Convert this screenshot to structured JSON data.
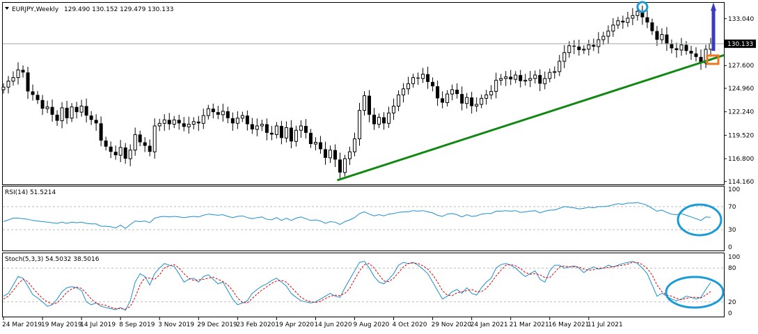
{
  "header": {
    "symbol": "EURJPY,Weekly",
    "ohlc": "129.490 130.152 129.479 130.133"
  },
  "chart_data": [
    {
      "type": "candlestick",
      "title": "EURJPY,Weekly",
      "ohlc": {
        "open": 129.49,
        "high": 130.152,
        "low": 129.479,
        "close": 130.133
      },
      "current_price": "130.133",
      "y_ticks": [
        "133.040",
        "127.600",
        "124.960",
        "122.240",
        "119.520",
        "116.800",
        "114.160"
      ],
      "ylim": [
        113.9,
        134.8
      ],
      "x_labels": [
        "24 Mar 2019",
        "19 May 2019",
        "14 Jul 2019",
        "8 Sep 2019",
        "3 Nov 2019",
        "29 Dec 2019",
        "23 Feb 2020",
        "19 Apr 2020",
        "14 Jun 2020",
        "9 Aug 2020",
        "4 Oct 2020",
        "29 Nov 2020",
        "24 Jan 2021",
        "21 Mar 2021",
        "16 May 2021",
        "11 Jul 2021"
      ],
      "closes": [
        125.1,
        125.8,
        126.2,
        127.1,
        126.8,
        124.6,
        124.2,
        123.6,
        122.6,
        122.8,
        121.9,
        121.2,
        122.7,
        121.5,
        122.8,
        122.2,
        122.9,
        121.8,
        121.3,
        120.9,
        118.9,
        118.2,
        117.6,
        117.2,
        118.1,
        116.8,
        117.8,
        119.6,
        118.7,
        118.3,
        117.6,
        120.6,
        120.9,
        121.3,
        120.8,
        121.3,
        120.9,
        120.5,
        120.8,
        121.1,
        120.9,
        121.8,
        122.6,
        122.2,
        121.9,
        122.3,
        121.5,
        120.9,
        121.5,
        121.8,
        120.8,
        120.2,
        120.6,
        120.8,
        119.8,
        119.6,
        120.6,
        119.2,
        120.4,
        118.8,
        120.1,
        120.6,
        119.8,
        118.5,
        118.7,
        117.9,
        116.9,
        117.8,
        116.7,
        115.2,
        116.8,
        117.6,
        119.1,
        122.4,
        124.1,
        121.9,
        120.8,
        121.6,
        120.9,
        122.1,
        122.9,
        124.2,
        124.9,
        125.5,
        126.2,
        126.1,
        126.6,
        125.7,
        125.2,
        123.8,
        123.3,
        124.3,
        124.8,
        124.3,
        123.2,
        123.9,
        122.9,
        123.1,
        123.8,
        124.2,
        124.6,
        125.9,
        126.1,
        126.3,
        126.0,
        126.5,
        125.8,
        125.9,
        126.1,
        126.5,
        125.5,
        126.1,
        126.8,
        126.9,
        128.1,
        129.1,
        129.9,
        129.8,
        129.4,
        129.5,
        130.0,
        129.8,
        130.6,
        131.0,
        131.6,
        132.3,
        132.8,
        132.6,
        133.1,
        133.4,
        133.9,
        133.2,
        132.6,
        131.6,
        130.6,
        131.2,
        130.1,
        129.6,
        129.4,
        130.0,
        129.3,
        129.0,
        128.6,
        127.9,
        129.49,
        130.133
      ],
      "overlays": [
        "green ascending trendline from Apr 2020 low to Aug 2021",
        "blue circle marks May 2021 high",
        "blue up arrow above last bar",
        "orange square at trendline touch"
      ],
      "colors": {
        "candle": "#000000",
        "trendline": "#118811",
        "highlight_circle": "#1a9bd7",
        "arrow": "#3b3bc2",
        "marker": "#f07822"
      }
    },
    {
      "type": "line",
      "title": "RSI(14) 51.5214",
      "y_ticks": [
        "100",
        "70",
        "30",
        "0"
      ],
      "ylim": [
        0,
        100
      ],
      "levels": [
        30,
        70
      ],
      "series": [
        {
          "name": "RSI(14)",
          "values": [
            44,
            47,
            50,
            50,
            49,
            48,
            46,
            45,
            44,
            43,
            42,
            41,
            43,
            41,
            43,
            42,
            43,
            41,
            40,
            40,
            36,
            36,
            35,
            33,
            38,
            32,
            39,
            45,
            44,
            45,
            42,
            50,
            52,
            53,
            52,
            53,
            52,
            51,
            52,
            53,
            52,
            55,
            57,
            56,
            55,
            56,
            53,
            51,
            53,
            54,
            51,
            49,
            51,
            52,
            48,
            47,
            51,
            46,
            50,
            46,
            50,
            52,
            49,
            46,
            47,
            45,
            41,
            44,
            43,
            39,
            44,
            47,
            51,
            58,
            61,
            57,
            54,
            56,
            54,
            57,
            58,
            60,
            61,
            61,
            63,
            62,
            63,
            61,
            59,
            55,
            53,
            57,
            58,
            56,
            52,
            56,
            53,
            54,
            57,
            58,
            58,
            62,
            62,
            63,
            62,
            63,
            60,
            61,
            62,
            63,
            59,
            62,
            64,
            64,
            67,
            70,
            69,
            68,
            66,
            67,
            69,
            68,
            70,
            70,
            71,
            73,
            75,
            74,
            76,
            76,
            77,
            75,
            72,
            67,
            62,
            64,
            60,
            57,
            56,
            58,
            55,
            52,
            49,
            46,
            52,
            51.5
          ]
        }
      ],
      "colors": {
        "line": "#1a8fcf",
        "levels": "#bbbbbb"
      }
    },
    {
      "type": "line",
      "title": "Stoch(5,3,3) 54.5032 38.5016",
      "y_ticks": [
        "100",
        "80",
        "20",
        "0"
      ],
      "ylim": [
        0,
        100
      ],
      "levels": [
        20,
        80
      ],
      "series": [
        {
          "name": "main",
          "values": [
            30,
            35,
            50,
            65,
            62,
            48,
            33,
            27,
            20,
            12,
            15,
            25,
            38,
            45,
            47,
            45,
            40,
            20,
            15,
            18,
            12,
            10,
            8,
            6,
            10,
            5,
            22,
            55,
            70,
            65,
            50,
            70,
            80,
            88,
            85,
            83,
            70,
            55,
            60,
            62,
            55,
            65,
            68,
            60,
            52,
            55,
            40,
            25,
            15,
            18,
            22,
            35,
            42,
            48,
            52,
            58,
            62,
            55,
            48,
            35,
            28,
            22,
            20,
            18,
            20,
            25,
            30,
            35,
            30,
            28,
            45,
            60,
            75,
            90,
            92,
            80,
            65,
            55,
            52,
            60,
            70,
            85,
            90,
            88,
            90,
            85,
            78,
            70,
            55,
            40,
            25,
            30,
            38,
            42,
            35,
            45,
            35,
            32,
            45,
            55,
            62,
            80,
            86,
            88,
            85,
            80,
            72,
            65,
            70,
            75,
            60,
            55,
            75,
            85,
            85,
            80,
            82,
            84,
            80,
            72,
            78,
            82,
            78,
            80,
            85,
            82,
            85,
            88,
            90,
            92,
            88,
            80,
            70,
            50,
            30,
            35,
            30,
            25,
            22,
            25,
            30,
            28,
            25,
            28,
            42,
            54.5
          ]
        },
        {
          "name": "signal",
          "values": [
            25,
            30,
            40,
            52,
            60,
            56,
            45,
            35,
            26,
            20,
            16,
            18,
            27,
            37,
            43,
            46,
            44,
            35,
            25,
            18,
            15,
            14,
            10,
            8,
            8,
            7,
            12,
            28,
            50,
            63,
            62,
            60,
            68,
            80,
            84,
            86,
            80,
            70,
            62,
            58,
            59,
            60,
            62,
            64,
            60,
            56,
            50,
            40,
            27,
            19,
            18,
            26,
            34,
            41,
            47,
            53,
            57,
            58,
            55,
            46,
            37,
            28,
            23,
            20,
            19,
            21,
            26,
            30,
            32,
            31,
            35,
            44,
            60,
            75,
            86,
            88,
            80,
            68,
            57,
            56,
            62,
            72,
            82,
            88,
            89,
            88,
            84,
            78,
            68,
            55,
            40,
            32,
            31,
            36,
            38,
            40,
            42,
            38,
            38,
            44,
            54,
            66,
            76,
            85,
            86,
            84,
            79,
            72,
            69,
            70,
            68,
            63,
            63,
            72,
            82,
            84,
            82,
            82,
            82,
            78,
            76,
            77,
            80,
            80,
            81,
            82,
            84,
            85,
            87,
            90,
            90,
            86,
            79,
            68,
            50,
            38,
            32,
            30,
            26,
            24,
            26,
            28,
            28,
            27,
            32,
            38.5
          ]
        }
      ],
      "colors": {
        "main": "#1a8fcf",
        "signal": "#dd0000",
        "levels": "#bbbbbb"
      }
    }
  ]
}
